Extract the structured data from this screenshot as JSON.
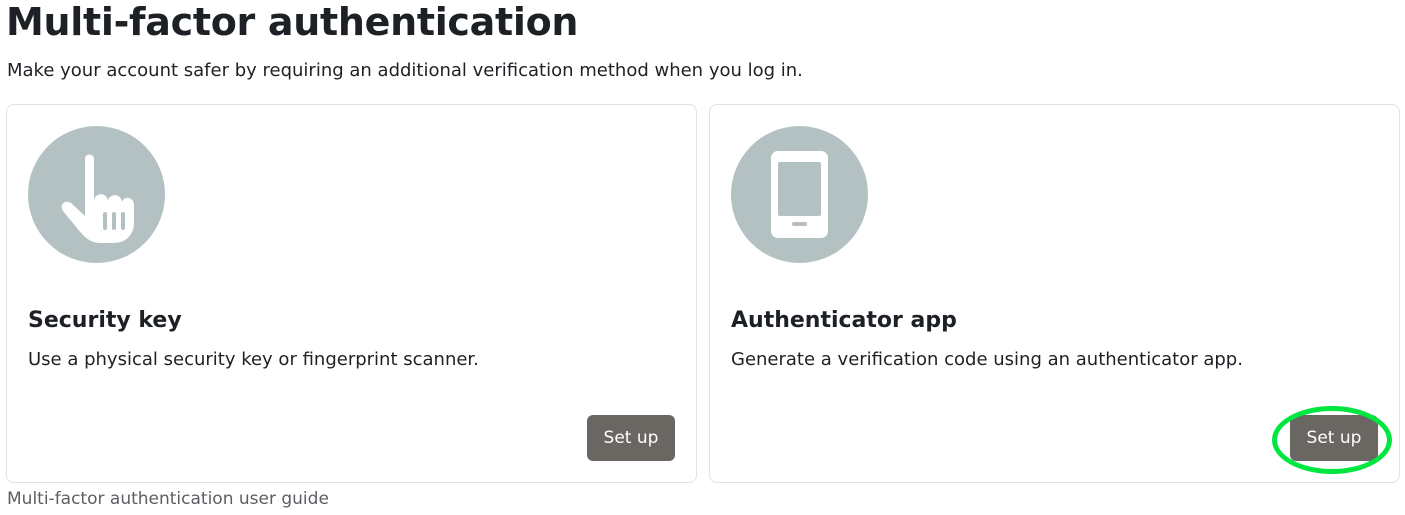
{
  "page": {
    "title": "Multi-factor authentication",
    "description": "Make your account safer by requiring an additional verification method when you log in."
  },
  "factors": [
    {
      "icon": "pointing-hand-icon",
      "title": "Security key",
      "description": "Use a physical security key or fingerprint scanner.",
      "button_label": "Set up"
    },
    {
      "icon": "smartphone-icon",
      "title": "Authenticator app",
      "description": "Generate a verification code using an authenticator app.",
      "button_label": "Set up",
      "highlighted": true
    }
  ],
  "footer": {
    "guide_link": "Multi-factor authentication user guide"
  },
  "colors": {
    "icon_circle": "#b4c1c3",
    "button_bg": "#6a6762",
    "highlight_ring": "#00e640",
    "card_border": "#dee2e6"
  }
}
